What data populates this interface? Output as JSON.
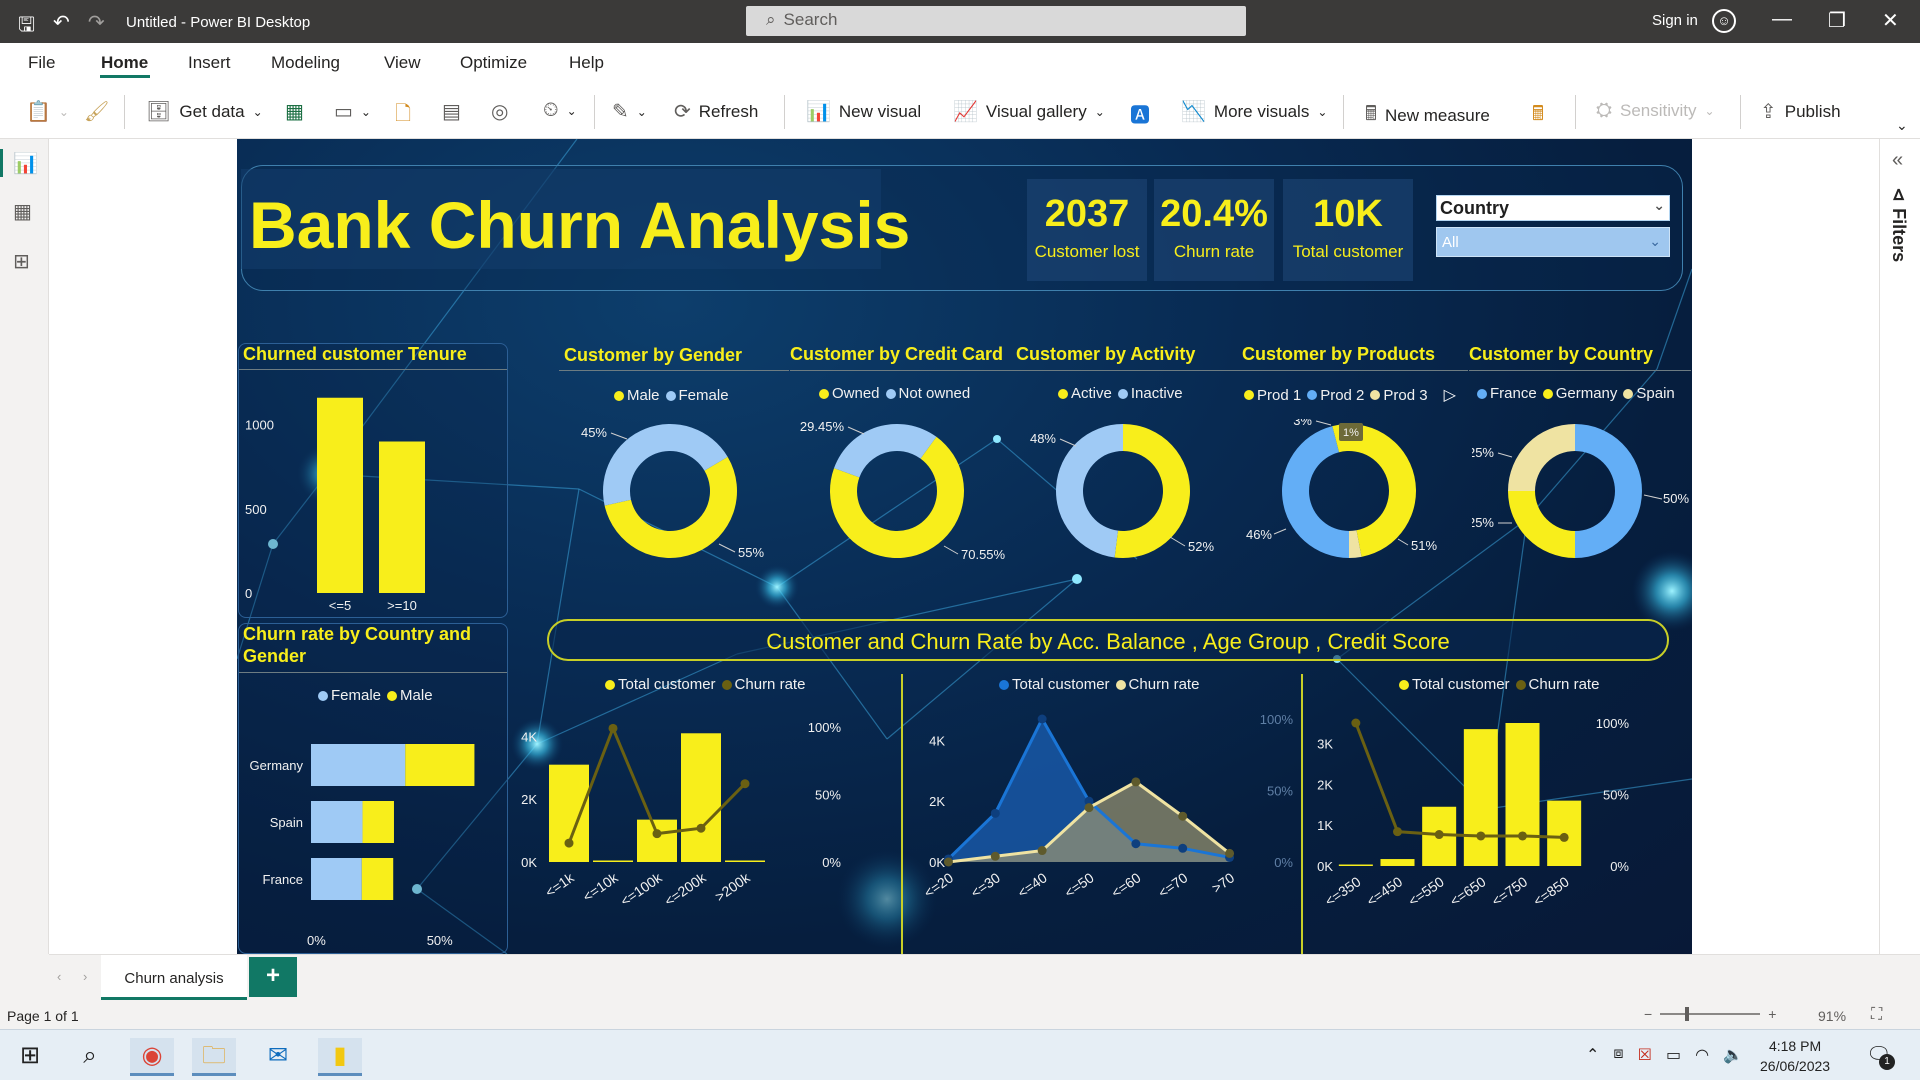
{
  "window": {
    "title": "Untitled - Power BI Desktop",
    "search_placeholder": "Search",
    "sign_in": "Sign in"
  },
  "menu": [
    "File",
    "Home",
    "Insert",
    "Modeling",
    "View",
    "Optimize",
    "Help"
  ],
  "ribbon": {
    "get_data": "Get data",
    "refresh": "Refresh",
    "new_visual": "New visual",
    "visual_gallery": "Visual gallery",
    "more_visuals": "More visuals",
    "new_measure": "New measure",
    "sensitivity": "Sensitivity",
    "publish": "Publish"
  },
  "filters_label": "Filters",
  "report": {
    "title": "Bank Churn Analysis",
    "kpis": [
      {
        "value": "2037",
        "label": "Customer lost"
      },
      {
        "value": "20.4%",
        "label": "Churn rate"
      },
      {
        "value": "10K",
        "label": "Total customer"
      }
    ],
    "slicer": {
      "title": "Country",
      "value": "All"
    },
    "visual_titles": {
      "tenure": "Churned customer Tenure",
      "gender": "Customer by Gender",
      "credit_card": "Customer by Credit Card",
      "activity": "Customer by Activity",
      "products": "Customer by Products",
      "country": "Customer by Country",
      "churn_country_gender_1": "Churn rate by Country and",
      "churn_country_gender_2": "Gender",
      "banner": "Customer and Churn Rate by Acc. Balance , Age Group , Credit Score"
    },
    "colors": {
      "yellow": "#f8ee1b",
      "light_blue": "#9fcaf5",
      "blue": "#63aef6",
      "pale": "#efe3a2",
      "olive": "#6a6012",
      "dark_blue": "#1a75d6"
    }
  },
  "chart_data": [
    {
      "id": "tenure",
      "type": "bar",
      "categories": [
        "<=5",
        ">=10"
      ],
      "values": [
        1160,
        900
      ],
      "ylim": [
        0,
        1200
      ],
      "yticks": [
        "0",
        "500",
        "1000"
      ]
    },
    {
      "id": "gender",
      "type": "pie",
      "legend": [
        "Male",
        "Female"
      ],
      "values": [
        55,
        45
      ],
      "labels": [
        "55%",
        "45%"
      ]
    },
    {
      "id": "credit_card",
      "type": "pie",
      "legend": [
        "Owned",
        "Not owned"
      ],
      "values": [
        70.55,
        29.45
      ],
      "labels": [
        "70.55%",
        "29.45%"
      ]
    },
    {
      "id": "activity",
      "type": "pie",
      "legend": [
        "Active",
        "Inactive"
      ],
      "values": [
        52,
        48
      ],
      "labels": [
        "52%",
        "48%"
      ]
    },
    {
      "id": "products",
      "type": "pie",
      "legend": [
        "Prod 1",
        "Prod 2",
        "Prod 3"
      ],
      "values": [
        46,
        51,
        3
      ],
      "labels": [
        "46%",
        "51%",
        "3%"
      ],
      "tooltip": "1%"
    },
    {
      "id": "country",
      "type": "pie",
      "legend": [
        "France",
        "Germany",
        "Spain"
      ],
      "values": [
        50,
        25,
        25
      ],
      "labels": [
        "50%",
        "25%",
        "25%"
      ]
    },
    {
      "id": "churn_country_gender",
      "type": "bar",
      "orientation": "horizontal-stacked",
      "legend": [
        "Female",
        "Male"
      ],
      "categories": [
        "Germany",
        "Spain",
        "France"
      ],
      "series": [
        {
          "name": "Female",
          "values": [
            37.5,
            20.5,
            20.2
          ]
        },
        {
          "name": "Male",
          "values": [
            27.5,
            12.5,
            12.5
          ]
        }
      ],
      "xlim": [
        0,
        70
      ],
      "xticks": [
        "0%",
        "50%"
      ]
    },
    {
      "id": "balance",
      "type": "bar",
      "legend": [
        "Total customer",
        "Churn rate"
      ],
      "categories": [
        "<=1k",
        "<=10k",
        "<=100k",
        "<=200k",
        ">200k"
      ],
      "series": [
        {
          "name": "Total customer",
          "values": [
            3100,
            15,
            1350,
            4100,
            10
          ]
        },
        {
          "name": "Churn rate",
          "values": [
            14,
            99,
            21,
            25,
            58
          ]
        }
      ],
      "y1ticks": [
        "0K",
        "2K",
        "4K"
      ],
      "y2ticks": [
        "0%",
        "50%",
        "100%"
      ],
      "y1lim": [
        0,
        4300
      ],
      "y2lim": [
        0,
        100
      ]
    },
    {
      "id": "age",
      "type": "area",
      "legend": [
        "Total customer",
        "Churn rate"
      ],
      "categories": [
        "<=20",
        "<=30",
        "<=40",
        "<=50",
        "<=60",
        "<=70",
        ">70"
      ],
      "series": [
        {
          "name": "Total customer",
          "values": [
            100,
            1600,
            4700,
            2000,
            600,
            450,
            150
          ]
        },
        {
          "name": "Churn rate",
          "values": [
            0,
            4,
            8,
            38,
            56,
            32,
            6
          ]
        }
      ],
      "y1ticks": [
        "0K",
        "2K",
        "4K"
      ],
      "y2ticks": [
        "0%",
        "50%",
        "100%"
      ],
      "y1lim": [
        0,
        4700
      ],
      "y2lim": [
        0,
        100
      ]
    },
    {
      "id": "credit_score",
      "type": "bar",
      "legend": [
        "Total customer",
        "Churn rate"
      ],
      "categories": [
        "<=350",
        "<=450",
        "<=550",
        "<=650",
        "<=750",
        "<=850"
      ],
      "series": [
        {
          "name": "Total customer",
          "values": [
            30,
            170,
            1450,
            3350,
            3500,
            1600
          ]
        },
        {
          "name": "Churn rate",
          "values": [
            100,
            24,
            22,
            21,
            21,
            20
          ]
        }
      ],
      "y1ticks": [
        "0K",
        "1K",
        "2K",
        "3K"
      ],
      "y2ticks": [
        "0%",
        "50%",
        "100%"
      ],
      "y1lim": [
        0,
        3500
      ],
      "y2lim": [
        0,
        100
      ]
    }
  ],
  "tabs": {
    "page": "Churn analysis",
    "add": "+"
  },
  "status": {
    "page": "Page 1 of 1",
    "zoom": "91%"
  },
  "taskbar": {
    "time": "4:18 PM",
    "date": "26/06/2023",
    "notifications": "1"
  }
}
